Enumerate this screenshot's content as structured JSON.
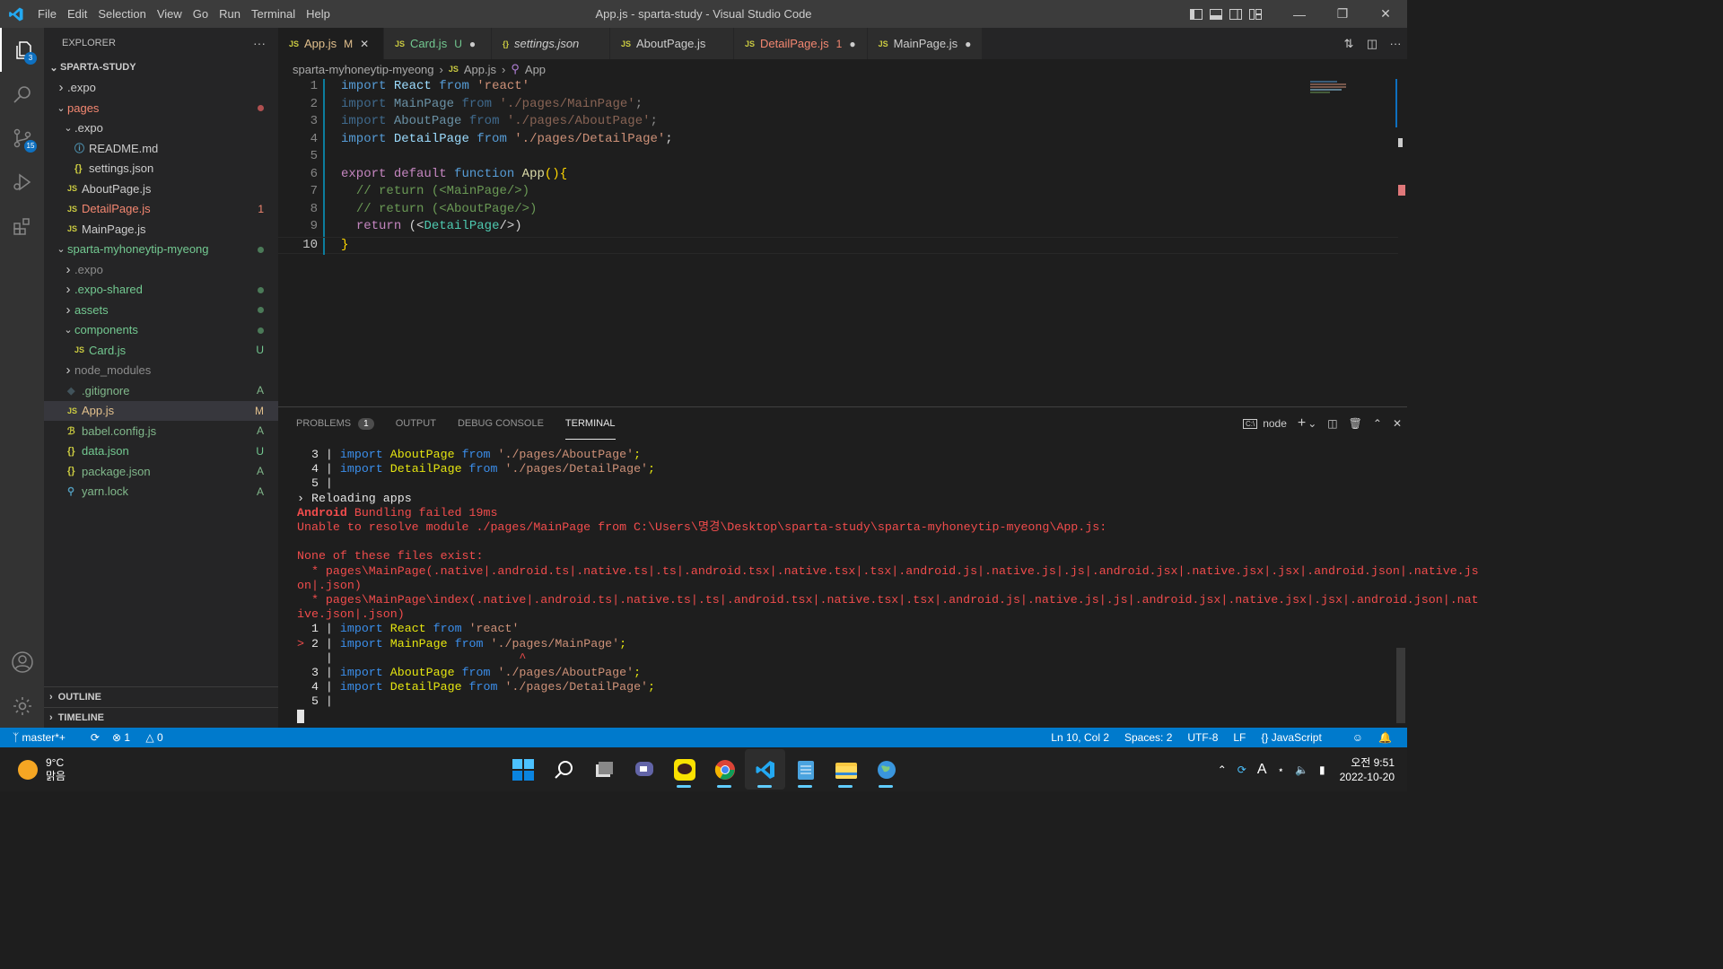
{
  "window": {
    "title": "App.js - sparta-study - Visual Studio Code"
  },
  "menu": [
    "File",
    "Edit",
    "Selection",
    "View",
    "Go",
    "Run",
    "Terminal",
    "Help"
  ],
  "activity": {
    "explorer_badge": "3",
    "scm_badge": "15"
  },
  "explorer": {
    "title": "EXPLORER",
    "more": "···",
    "root": "SPARTA-STUDY",
    "items": [
      {
        "label": ".expo",
        "indent": 1,
        "type": "folder-closed",
        "color": "#cccccc",
        "dec": ""
      },
      {
        "label": "pages",
        "indent": 1,
        "type": "folder-open",
        "color": "#f48771",
        "dec": "dot-red"
      },
      {
        "label": ".expo",
        "indent": 2,
        "type": "folder-open",
        "color": "#cccccc",
        "dec": ""
      },
      {
        "label": "README.md",
        "indent": 3,
        "type": "info",
        "color": "#cccccc",
        "dec": ""
      },
      {
        "label": "settings.json",
        "indent": 3,
        "type": "json",
        "color": "#cccccc",
        "dec": ""
      },
      {
        "label": "AboutPage.js",
        "indent": 2,
        "type": "js",
        "color": "#cccccc",
        "dec": ""
      },
      {
        "label": "DetailPage.js",
        "indent": 2,
        "type": "js",
        "color": "#f48771",
        "dec": "1"
      },
      {
        "label": "MainPage.js",
        "indent": 2,
        "type": "js",
        "color": "#cccccc",
        "dec": ""
      },
      {
        "label": "sparta-myhoneytip-myeong",
        "indent": 1,
        "type": "folder-open",
        "color": "#73c991",
        "dec": "dot-green"
      },
      {
        "label": ".expo",
        "indent": 2,
        "type": "folder-closed",
        "color": "#8c8c8c",
        "dec": ""
      },
      {
        "label": ".expo-shared",
        "indent": 2,
        "type": "folder-closed",
        "color": "#73c991",
        "dec": "dot-green"
      },
      {
        "label": "assets",
        "indent": 2,
        "type": "folder-closed",
        "color": "#73c991",
        "dec": "dot-green"
      },
      {
        "label": "components",
        "indent": 2,
        "type": "folder-open",
        "color": "#73c991",
        "dec": "dot-green"
      },
      {
        "label": "Card.js",
        "indent": 3,
        "type": "js",
        "color": "#73c991",
        "dec": "U"
      },
      {
        "label": "node_modules",
        "indent": 2,
        "type": "folder-closed",
        "color": "#8c8c8c",
        "dec": ""
      },
      {
        "label": ".gitignore",
        "indent": 2,
        "type": "git",
        "color": "#81b88b",
        "dec": "A"
      },
      {
        "label": "App.js",
        "indent": 2,
        "type": "js",
        "color": "#e2c08d",
        "dec": "M",
        "selected": true
      },
      {
        "label": "babel.config.js",
        "indent": 2,
        "type": "babel",
        "color": "#81b88b",
        "dec": "A"
      },
      {
        "label": "data.json",
        "indent": 2,
        "type": "json",
        "color": "#73c991",
        "dec": "U"
      },
      {
        "label": "package.json",
        "indent": 2,
        "type": "json",
        "color": "#81b88b",
        "dec": "A"
      },
      {
        "label": "yarn.lock",
        "indent": 2,
        "type": "yarn",
        "color": "#81b88b",
        "dec": "A"
      }
    ],
    "outline": "OUTLINE",
    "timeline": "TIMELINE"
  },
  "tabs": [
    {
      "label": "App.js",
      "icon": "JS",
      "status": "M",
      "color": "#e2c08d",
      "active": true,
      "close": "✕"
    },
    {
      "label": "Card.js",
      "icon": "JS",
      "status": "U",
      "color": "#73c991",
      "active": false,
      "close": "●"
    },
    {
      "label": "settings.json",
      "icon": "{}",
      "status": "",
      "color": "#cccccc",
      "active": false,
      "close": "",
      "italic": true
    },
    {
      "label": "AboutPage.js",
      "icon": "JS",
      "status": "",
      "color": "#cccccc",
      "active": false,
      "close": ""
    },
    {
      "label": "DetailPage.js",
      "icon": "JS",
      "status": "1",
      "color": "#f48771",
      "active": false,
      "close": "●"
    },
    {
      "label": "MainPage.js",
      "icon": "JS",
      "status": "",
      "color": "#cccccc",
      "active": false,
      "close": "●"
    }
  ],
  "breadcrumb": [
    "sparta-myhoneytip-myeong",
    "›",
    "App.js",
    "›",
    "App"
  ],
  "code": {
    "lines": [
      {
        "n": "1",
        "tokens": [
          [
            "kw",
            "import"
          ],
          [
            "pun",
            " "
          ],
          [
            "id",
            "React"
          ],
          [
            "pun",
            " "
          ],
          [
            "kw",
            "from"
          ],
          [
            "pun",
            " "
          ],
          [
            "str",
            "'react'"
          ]
        ]
      },
      {
        "n": "2",
        "dim": true,
        "tokens": [
          [
            "kw",
            "import"
          ],
          [
            "pun",
            " "
          ],
          [
            "id",
            "MainPage"
          ],
          [
            "pun",
            " "
          ],
          [
            "kw",
            "from"
          ],
          [
            "pun",
            " "
          ],
          [
            "str",
            "'./pages/MainPage'"
          ],
          [
            "pun",
            ";"
          ]
        ]
      },
      {
        "n": "3",
        "dim": true,
        "tokens": [
          [
            "kw",
            "import"
          ],
          [
            "pun",
            " "
          ],
          [
            "id",
            "AboutPage"
          ],
          [
            "pun",
            " "
          ],
          [
            "kw",
            "from"
          ],
          [
            "pun",
            " "
          ],
          [
            "str",
            "'./pages/AboutPage'"
          ],
          [
            "pun",
            ";"
          ]
        ]
      },
      {
        "n": "4",
        "tokens": [
          [
            "kw",
            "import"
          ],
          [
            "pun",
            " "
          ],
          [
            "id",
            "DetailPage"
          ],
          [
            "pun",
            " "
          ],
          [
            "kw",
            "from"
          ],
          [
            "pun",
            " "
          ],
          [
            "str",
            "'./pages/DetailPage'"
          ],
          [
            "pun",
            ";"
          ]
        ]
      },
      {
        "n": "5",
        "tokens": []
      },
      {
        "n": "6",
        "tokens": [
          [
            "kw2",
            "export"
          ],
          [
            "pun",
            " "
          ],
          [
            "kw2",
            "default"
          ],
          [
            "pun",
            " "
          ],
          [
            "kw",
            "function"
          ],
          [
            "pun",
            " "
          ],
          [
            "fn",
            "App"
          ],
          [
            "brk",
            "()"
          ],
          [
            "brk",
            "{"
          ]
        ]
      },
      {
        "n": "7",
        "tokens": [
          [
            "pun",
            "  "
          ],
          [
            "cm",
            "// return (<MainPage/>)"
          ]
        ]
      },
      {
        "n": "8",
        "tokens": [
          [
            "pun",
            "  "
          ],
          [
            "cm",
            "// return (<AboutPage/>)"
          ]
        ]
      },
      {
        "n": "9",
        "tokens": [
          [
            "pun",
            "  "
          ],
          [
            "kw2",
            "return"
          ],
          [
            "pun",
            " ("
          ],
          [
            "pun",
            "<"
          ],
          [
            "tag",
            "DetailPage"
          ],
          [
            "pun",
            "/>)"
          ]
        ]
      },
      {
        "n": "10",
        "cur": true,
        "tokens": [
          [
            "brk",
            "}"
          ]
        ]
      }
    ]
  },
  "panel": {
    "tabs": [
      "PROBLEMS",
      "OUTPUT",
      "DEBUG CONSOLE",
      "TERMINAL"
    ],
    "problems_count": "1",
    "terminal_name": "node",
    "terminal": [
      [
        [
          "tw",
          "  3 | "
        ],
        [
          "tbl",
          "import"
        ],
        [
          "tw",
          " "
        ],
        [
          "tye",
          "AboutPage"
        ],
        [
          "tw",
          " "
        ],
        [
          "tbl",
          "from"
        ],
        [
          "tw",
          " "
        ],
        [
          "tst",
          "'./pages/AboutPage'"
        ],
        [
          "tye",
          ";"
        ]
      ],
      [
        [
          "tw",
          "  4 | "
        ],
        [
          "tbl",
          "import"
        ],
        [
          "tw",
          " "
        ],
        [
          "tye",
          "DetailPage"
        ],
        [
          "tw",
          " "
        ],
        [
          "tbl",
          "from"
        ],
        [
          "tw",
          " "
        ],
        [
          "tst",
          "'./pages/DetailPage'"
        ],
        [
          "tye",
          ";"
        ]
      ],
      [
        [
          "tw",
          "  5 |"
        ]
      ],
      [
        [
          "tw",
          "› Reloading apps"
        ]
      ],
      [
        [
          "tredb",
          "Android"
        ],
        [
          "tred",
          " Bundling failed 19ms"
        ]
      ],
      [
        [
          "tred",
          "Unable to resolve module ./pages/MainPage from C:\\Users\\명경\\Desktop\\sparta-study\\sparta-myhoneytip-myeong\\App.js:"
        ]
      ],
      [
        [
          "tw",
          ""
        ]
      ],
      [
        [
          "tred",
          "None of these files exist:"
        ]
      ],
      [
        [
          "tred",
          "  * pages\\MainPage(.native|.android.ts|.native.ts|.ts|.android.tsx|.native.tsx|.tsx|.android.js|.native.js|.js|.android.jsx|.native.jsx|.jsx|.android.json|.native.js"
        ]
      ],
      [
        [
          "tred",
          "on|.json)"
        ]
      ],
      [
        [
          "tred",
          "  * pages\\MainPage\\index(.native|.android.ts|.native.ts|.ts|.android.tsx|.native.tsx|.tsx|.android.js|.native.js|.js|.android.jsx|.native.jsx|.jsx|.android.json|.nat"
        ]
      ],
      [
        [
          "tred",
          "ive.json|.json)"
        ]
      ],
      [
        [
          "tw",
          "  1 | "
        ],
        [
          "tbl",
          "import"
        ],
        [
          "tw",
          " "
        ],
        [
          "tye",
          "React"
        ],
        [
          "tw",
          " "
        ],
        [
          "tbl",
          "from"
        ],
        [
          "tw",
          " "
        ],
        [
          "tst",
          "'react'"
        ]
      ],
      [
        [
          "tred",
          "> "
        ],
        [
          "tw",
          "2 | "
        ],
        [
          "tbl",
          "import"
        ],
        [
          "tw",
          " "
        ],
        [
          "tye",
          "MainPage"
        ],
        [
          "tw",
          " "
        ],
        [
          "tbl",
          "from"
        ],
        [
          "tw",
          " "
        ],
        [
          "tst",
          "'./pages/MainPage'"
        ],
        [
          "tye",
          ";"
        ]
      ],
      [
        [
          "tw",
          "    |                          "
        ],
        [
          "tred",
          "^"
        ]
      ],
      [
        [
          "tw",
          "  3 | "
        ],
        [
          "tbl",
          "import"
        ],
        [
          "tw",
          " "
        ],
        [
          "tye",
          "AboutPage"
        ],
        [
          "tw",
          " "
        ],
        [
          "tbl",
          "from"
        ],
        [
          "tw",
          " "
        ],
        [
          "tst",
          "'./pages/AboutPage'"
        ],
        [
          "tye",
          ";"
        ]
      ],
      [
        [
          "tw",
          "  4 | "
        ],
        [
          "tbl",
          "import"
        ],
        [
          "tw",
          " "
        ],
        [
          "tye",
          "DetailPage"
        ],
        [
          "tw",
          " "
        ],
        [
          "tbl",
          "from"
        ],
        [
          "tw",
          " "
        ],
        [
          "tst",
          "'./pages/DetailPage'"
        ],
        [
          "tye",
          ";"
        ]
      ],
      [
        [
          "tw",
          "  5 |"
        ]
      ],
      [
        [
          "tw",
          "█"
        ]
      ]
    ]
  },
  "status": {
    "branch": "master*+",
    "sync": "⟳",
    "errors": "1",
    "warnings": "0",
    "position": "Ln 10, Col 2",
    "spaces": "Spaces: 2",
    "encoding": "UTF-8",
    "eol": "LF",
    "language": "JavaScript"
  },
  "taskbar": {
    "temp": "9°C",
    "weather": "맑음",
    "ampm_time": "오전 9:51",
    "date": "2022-10-20",
    "ime": "A"
  }
}
